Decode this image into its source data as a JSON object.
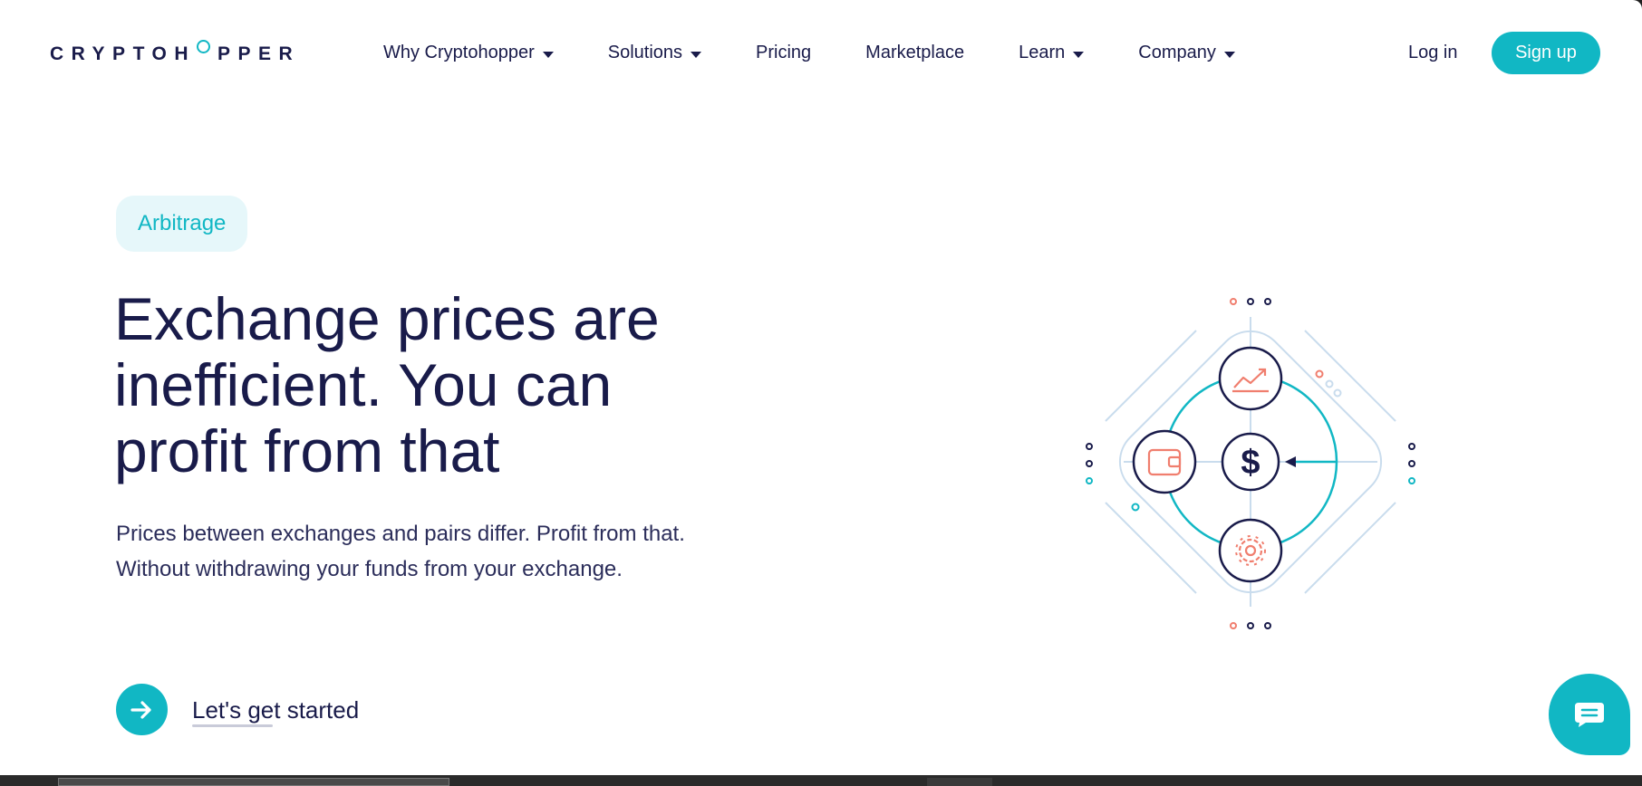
{
  "header": {
    "logo_left": "CRYPTOH",
    "logo_right": "PPER",
    "nav": [
      {
        "label": "Why Cryptohopper",
        "has_dropdown": true
      },
      {
        "label": "Solutions",
        "has_dropdown": true
      },
      {
        "label": "Pricing",
        "has_dropdown": false
      },
      {
        "label": "Marketplace",
        "has_dropdown": false
      },
      {
        "label": "Learn",
        "has_dropdown": true
      },
      {
        "label": "Company",
        "has_dropdown": true
      }
    ],
    "login_label": "Log in",
    "signup_label": "Sign up"
  },
  "hero": {
    "badge": "Arbitrage",
    "headline_line1": "Exchange prices are",
    "headline_line2": "inefficient. You can",
    "headline_line3": "profit from that",
    "subtext_line1": "Prices between exchanges and pairs differ. Profit from that.",
    "subtext_line2": "Without withdrawing your funds from your exchange.",
    "cta_label": "Let's get started",
    "cta_icon": "arrow-right-icon"
  },
  "illustration": {
    "center_symbol": "$",
    "icons": [
      "chart-up-icon",
      "wallet-icon",
      "dollar-icon",
      "gear-icon"
    ]
  },
  "colors": {
    "accent": "#11b7c4",
    "navy": "#191b4a",
    "coral": "#f07e6e",
    "badge_bg": "#e6f7fa",
    "line_light": "#c9dced"
  },
  "chat": {
    "icon": "chat-bubble-icon"
  }
}
